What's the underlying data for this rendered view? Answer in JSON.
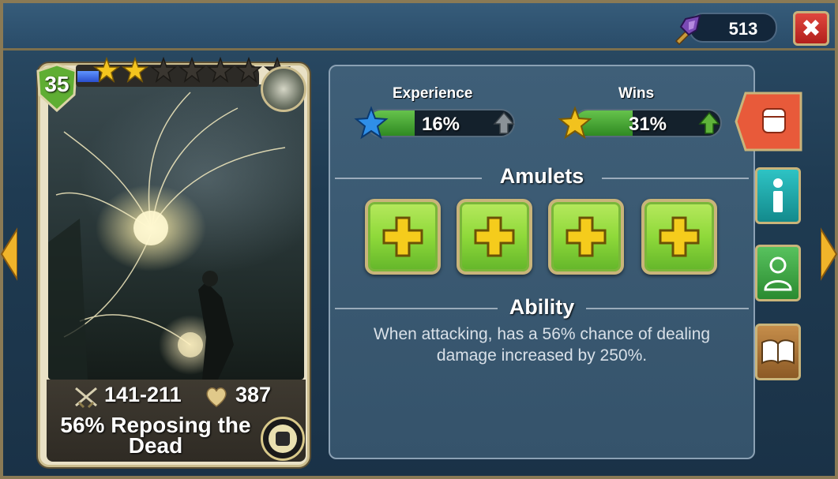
{
  "header": {
    "currency_value": "513",
    "currency_icon": "purple-sword-icon",
    "close_icon": "close-icon"
  },
  "card": {
    "level": "35",
    "stars_filled": 2,
    "stars_total": 7,
    "star_progress": 0.12,
    "attack": "141-211",
    "hp": "387",
    "skill_line1": "56% Reposing the",
    "skill_line2": "Dead",
    "class_icon": "spirit-class-icon",
    "skill_icon": "fist-skill-icon"
  },
  "stats": {
    "experience_label": "Experience",
    "experience_value": "16%",
    "experience_fraction": 0.16,
    "wins_label": "Wins",
    "wins_value": "31%",
    "wins_fraction": 0.31
  },
  "amulets": {
    "title": "Amulets",
    "slots": [
      {
        "icon": "plus-icon"
      },
      {
        "icon": "plus-icon"
      },
      {
        "icon": "plus-icon"
      },
      {
        "icon": "plus-icon"
      }
    ]
  },
  "ability": {
    "title": "Ability",
    "line1": "When attacking, has a 56% chance of dealing",
    "line2": "damage increased by 250%."
  },
  "side_tabs": [
    {
      "name": "fight",
      "icon": "fist-icon",
      "color": "#e85a3a"
    },
    {
      "name": "info",
      "icon": "info-icon",
      "color": "#1fa7a8"
    },
    {
      "name": "evolve",
      "icon": "figure-icon",
      "color": "#3aa643"
    },
    {
      "name": "lore",
      "icon": "book-icon",
      "color": "#b07a3e"
    }
  ],
  "colors": {
    "accent_green": "#8fd93a",
    "accent_gold": "#c9b47a",
    "close_red": "#d0322c"
  }
}
